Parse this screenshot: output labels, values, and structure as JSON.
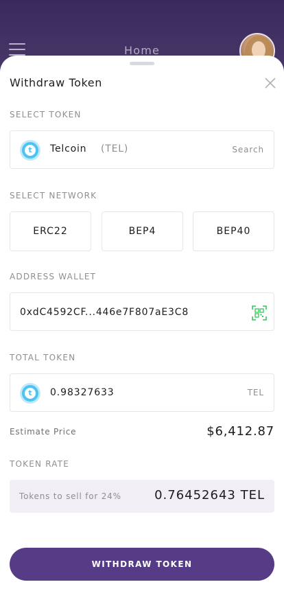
{
  "header": {
    "title": "Home",
    "menu_icon": "hamburger-icon",
    "avatar_icon": "avatar"
  },
  "sheet": {
    "title": "Withdraw Token",
    "close_icon": "close-icon"
  },
  "select_token": {
    "label": "SELECT TOKEN",
    "token_name": "Telcoin",
    "token_symbol": "(TEL)",
    "search_label": "Search",
    "coin_letter": "t",
    "coin_color": "#4cc4f1"
  },
  "select_network": {
    "label": "SELECT NETWORK",
    "options": [
      "ERC22",
      "BEP4",
      "BEP40"
    ]
  },
  "address_wallet": {
    "label": "ADDRESS WALLET",
    "value": "0xdC4592CF...446e7F807aE3C8",
    "scan_icon": "qr-scan-icon"
  },
  "total_token": {
    "label": "TOTAL TOKEN",
    "amount": "0.98327633",
    "unit": "TEL",
    "coin_letter": "t"
  },
  "estimate": {
    "label": "Estimate Price",
    "value": "$6,412.87"
  },
  "token_rate": {
    "label": "TOKEN RATE",
    "description": "Tokens to sell for 24%",
    "value": "0.76452643 TEL"
  },
  "actions": {
    "withdraw_label": "WITHDRAW TOKEN"
  },
  "colors": {
    "brand": "#563c86",
    "header_bg": "#3b2a5e",
    "accent_green": "#34c759",
    "coin_blue": "#4cc4f1"
  }
}
